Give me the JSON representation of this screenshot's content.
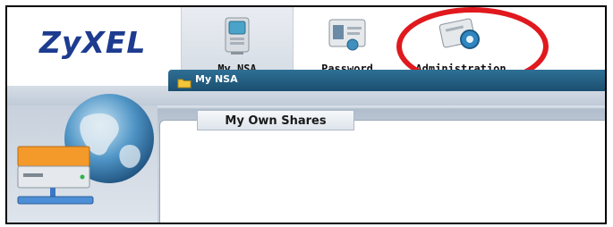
{
  "brand": {
    "logo_text": "ZyXEL",
    "logo_color": "#1d3c90"
  },
  "nav": {
    "tabs": [
      {
        "label": "My NSA",
        "icon": "nsa-device-icon",
        "active": true
      },
      {
        "label": "Password",
        "icon": "id-card-icon",
        "active": false
      },
      {
        "label": "Administration",
        "icon": "admin-gear-icon",
        "active": false
      }
    ]
  },
  "panel": {
    "title": "My NSA",
    "icon": "folder-icon"
  },
  "subtabs": [
    {
      "label": "My Own Shares"
    }
  ],
  "sidebar": {
    "icons": [
      "globe-icon",
      "nas-drive-icon"
    ]
  },
  "annotation": {
    "type": "highlight-circle",
    "target": "Administration",
    "color": "#e0191e"
  }
}
